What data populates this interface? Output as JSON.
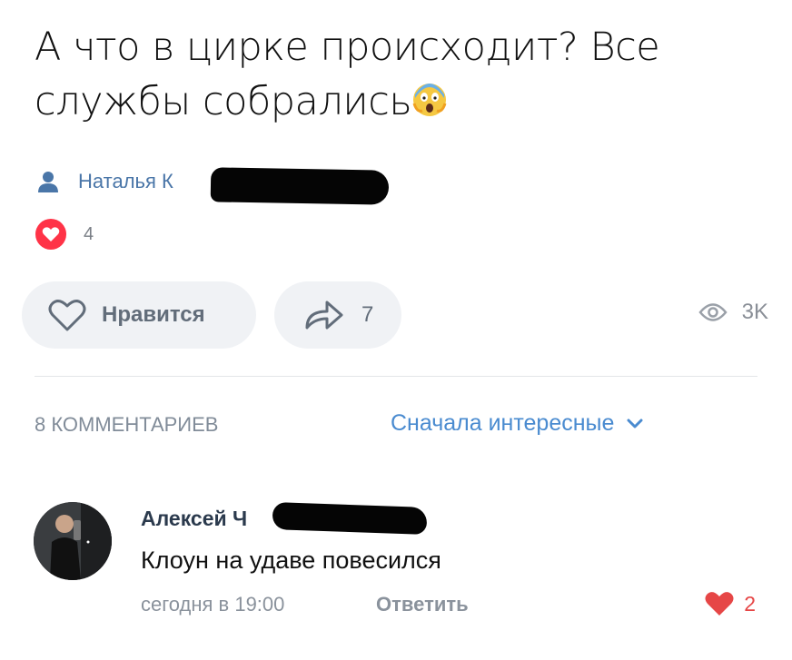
{
  "post": {
    "text": "А что в цирке происходит? Все службы собрались",
    "emoji": "screaming-face-emoji",
    "author_visible": "Наталья К",
    "reaction_count": "4"
  },
  "actions": {
    "like_label": "Нравится",
    "share_count": "7",
    "views": "3K"
  },
  "comments": {
    "count_label": "8 КОММЕНТАРИЕВ",
    "sort_label": "Сначала интересные",
    "items": [
      {
        "author_visible": "Алексей Ч",
        "text": "Клоун на удаве повесился",
        "time": "сегодня в 19:00",
        "reply_label": "Ответить",
        "likes": "2"
      }
    ]
  },
  "colors": {
    "accent": "#4a8bd0",
    "link": "#4a76a8",
    "like_red": "#e64646",
    "muted": "#818c99"
  }
}
